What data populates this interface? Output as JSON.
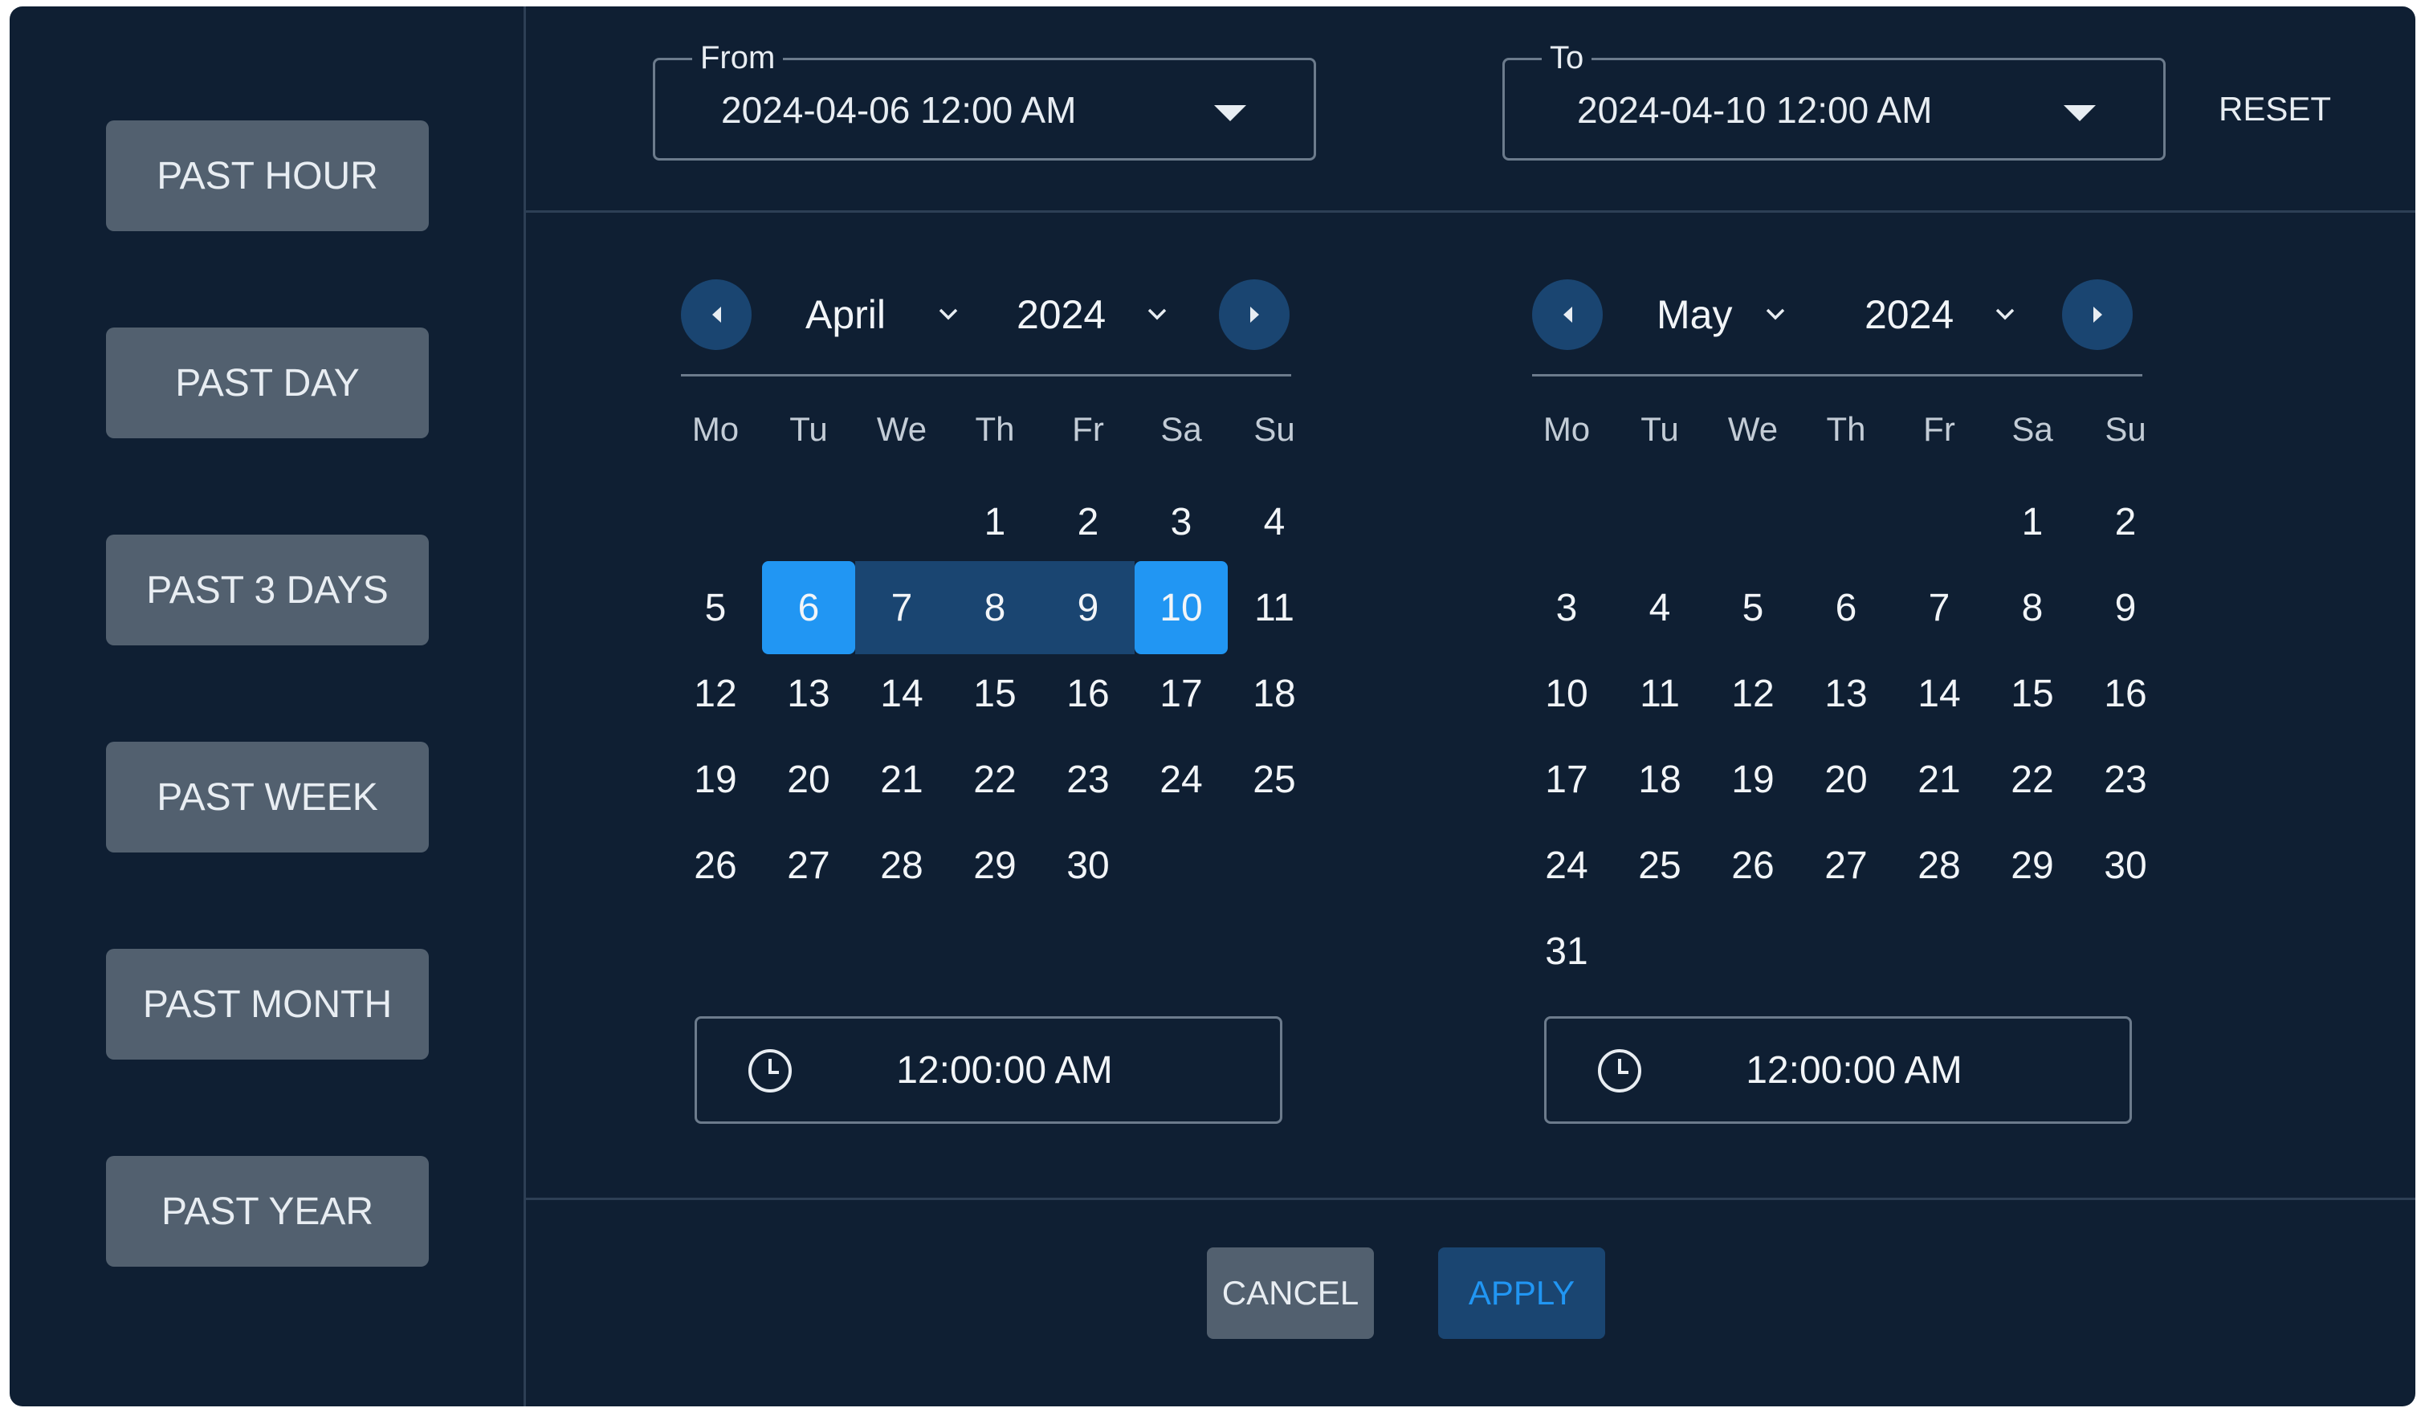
{
  "presets": [
    "PAST HOUR",
    "PAST DAY",
    "PAST 3 DAYS",
    "PAST WEEK",
    "PAST MONTH",
    "PAST YEAR"
  ],
  "from": {
    "label": "From",
    "value": "2024-04-06 12:00 AM"
  },
  "to": {
    "label": "To",
    "value": "2024-04-10 12:00 AM"
  },
  "reset_label": "RESET",
  "weekdays": [
    "Mo",
    "Tu",
    "We",
    "Th",
    "Fr",
    "Sa",
    "Su"
  ],
  "calendars": [
    {
      "month": "April",
      "year": "2024",
      "first_weekday": 3,
      "days": 30,
      "selected_start": 6,
      "selected_end": 10,
      "time": "12:00:00 AM"
    },
    {
      "month": "May",
      "year": "2024",
      "first_weekday": 5,
      "days": 31,
      "selected_start": null,
      "selected_end": null,
      "time": "12:00:00 AM"
    }
  ],
  "actions": {
    "cancel": "CANCEL",
    "apply": "APPLY"
  },
  "colors": {
    "background": "#0f1f33",
    "accent": "#2196f3",
    "range": "#1a4571",
    "button": "#52606f",
    "divider": "#2d3f55"
  },
  "icons": {
    "prev": "chevron-left-icon",
    "next": "chevron-right-icon",
    "dropdown": "caret-down-icon",
    "time": "clock-icon"
  }
}
